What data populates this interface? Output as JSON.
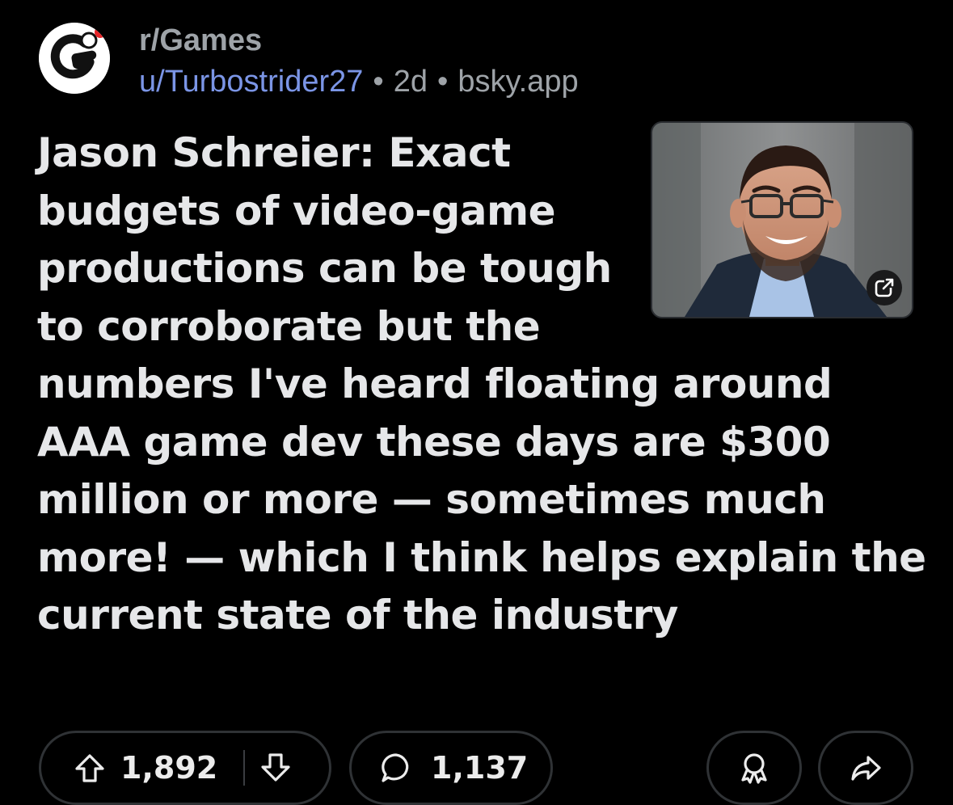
{
  "post": {
    "subreddit": "r/Games",
    "author": "u/Turbostrider27",
    "age": "2d",
    "domain": "bsky.app",
    "separator": "•",
    "title": "Jason Schreier: Exact budgets of video-game productions can be tough to corroborate but the numbers I've heard floating around AAA game dev these days are $300 million or more — sometimes much more! — which I think helps explain the current state of the industry"
  },
  "actions": {
    "upvotes": "1,892",
    "comments": "1,137"
  },
  "icons": {
    "subreddit_avatar": "games-subreddit-logo",
    "thumbnail": "article-thumbnail-photo",
    "external": "external-link-icon",
    "upvote": "upvote-arrow-icon",
    "downvote": "downvote-arrow-icon",
    "comment": "comment-bubble-icon",
    "award": "award-icon",
    "share": "share-arrow-icon"
  },
  "colors": {
    "background": "#000000",
    "author": "#7b95e6",
    "meta": "#9ea3a8",
    "title": "#e6e7e9",
    "pill_border": "#2f3235",
    "avatar_accent": "#e8262a"
  }
}
